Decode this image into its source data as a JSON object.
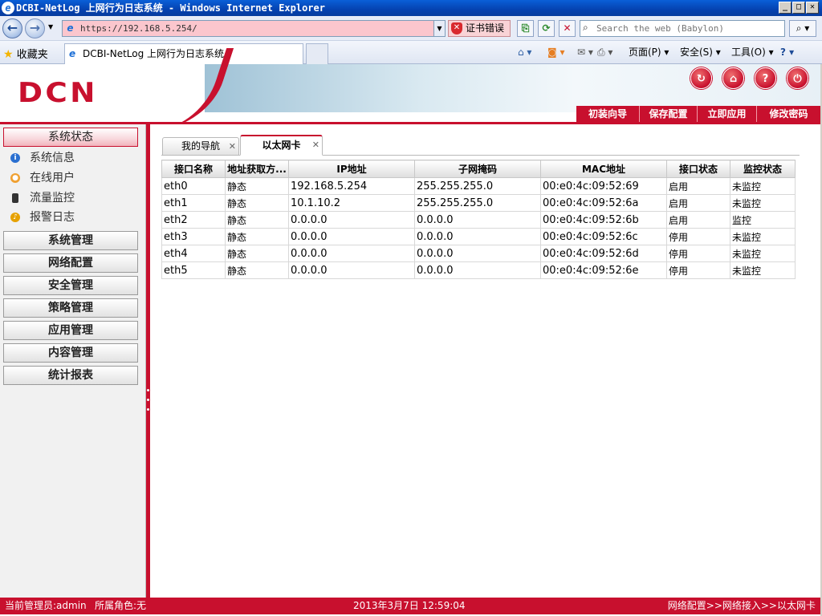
{
  "window": {
    "title": "DCBI-NetLog 上网行为日志系统 - Windows Internet Explorer",
    "minimize": "_",
    "maximize": "□",
    "close": "✕"
  },
  "browser": {
    "address": "https://192.168.5.254/",
    "cert_error": "证书错误",
    "search_placeholder": "Search the web (Babylon)",
    "favorites_label": "收藏夹",
    "tab_title": "DCBI-NetLog 上网行为日志系统",
    "cmd_page": "页面(P)",
    "cmd_safety": "安全(S)",
    "cmd_tools": "工具(O)"
  },
  "app": {
    "logo_text": "DCN",
    "header_actions": [
      "初装向导",
      "保存配置",
      "立即应用",
      "修改密码"
    ],
    "colors": {
      "accent": "#c8102e",
      "sidebar_bg": "#f1f1f1"
    }
  },
  "sidebar": {
    "active_group": "系统状态",
    "sub_items": [
      {
        "label": "系统信息",
        "icon": "info-icon"
      },
      {
        "label": "在线用户",
        "icon": "user-icon"
      },
      {
        "label": "流量监控",
        "icon": "traffic-light-icon"
      },
      {
        "label": "报警日志",
        "icon": "alarm-bell-icon"
      }
    ],
    "groups": [
      "系统管理",
      "网络配置",
      "安全管理",
      "策略管理",
      "应用管理",
      "内容管理",
      "统计报表"
    ]
  },
  "content": {
    "tabs": [
      "我的导航",
      "以太网卡"
    ],
    "active_tab": "以太网卡",
    "table": {
      "headers": [
        "接口名称",
        "地址获取方...",
        "IP地址",
        "子网掩码",
        "MAC地址",
        "接口状态",
        "监控状态"
      ],
      "rows": [
        [
          "eth0",
          "静态",
          "192.168.5.254",
          "255.255.255.0",
          "00:e0:4c:09:52:69",
          "启用",
          "未监控"
        ],
        [
          "eth1",
          "静态",
          "10.1.10.2",
          "255.255.255.0",
          "00:e0:4c:09:52:6a",
          "启用",
          "未监控"
        ],
        [
          "eth2",
          "静态",
          "0.0.0.0",
          "0.0.0.0",
          "00:e0:4c:09:52:6b",
          "启用",
          "监控"
        ],
        [
          "eth3",
          "静态",
          "0.0.0.0",
          "0.0.0.0",
          "00:e0:4c:09:52:6c",
          "停用",
          "未监控"
        ],
        [
          "eth4",
          "静态",
          "0.0.0.0",
          "0.0.0.0",
          "00:e0:4c:09:52:6d",
          "停用",
          "未监控"
        ],
        [
          "eth5",
          "静态",
          "0.0.0.0",
          "0.0.0.0",
          "00:e0:4c:09:52:6e",
          "停用",
          "未监控"
        ]
      ]
    }
  },
  "status": {
    "admin": "当前管理员:admin",
    "role": "所属角色:无",
    "datetime": "2013年3月7日 12:59:04",
    "breadcrumb": "网络配置>>网络接入>>以太网卡"
  }
}
